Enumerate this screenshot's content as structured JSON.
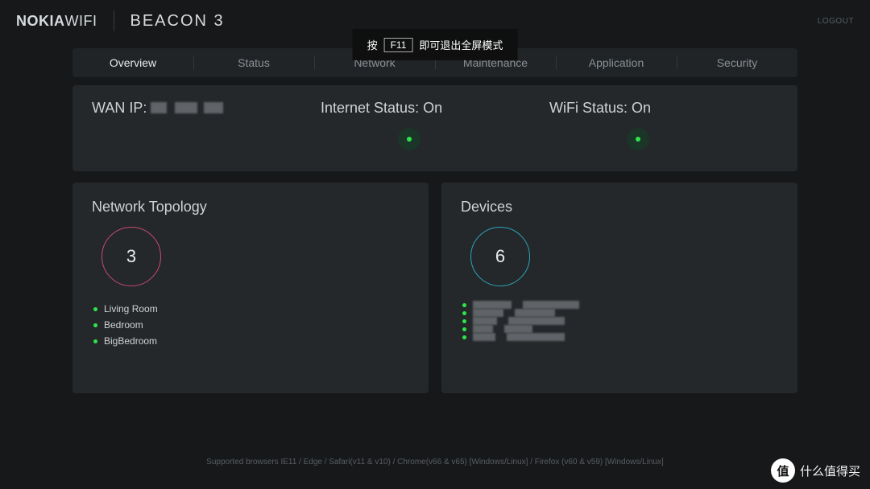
{
  "brand": {
    "bold": "NOKIA",
    "thin": "WIFI",
    "product": "BEACON 3"
  },
  "logout": "LOGOUT",
  "tabs": [
    "Overview",
    "Status",
    "Network",
    "Maintenance",
    "Application",
    "Security"
  ],
  "active_tab": 0,
  "status": {
    "wan_label": "WAN IP:",
    "internet_label": "Internet Status: On",
    "wifi_label": "WiFi Status: On",
    "internet_on": true,
    "wifi_on": true
  },
  "topology": {
    "title": "Network Topology",
    "count": "3",
    "items": [
      "Living Room",
      "Bedroom",
      "BigBedroom"
    ]
  },
  "devices": {
    "title": "Devices",
    "count": "6",
    "masked_rows": 5
  },
  "footer": "Supported browsers IE11 / Edge / Safari(v11 & v10) / Chrome(v66 & v65) [Windows/Linux] / Firefox (v60 & v59) [Windows/Linux]",
  "fullscreen_toast": {
    "pre": "按",
    "key": "F11",
    "post": "即可退出全屏模式"
  },
  "watermark": {
    "badge": "值",
    "text": "什么值得买"
  }
}
